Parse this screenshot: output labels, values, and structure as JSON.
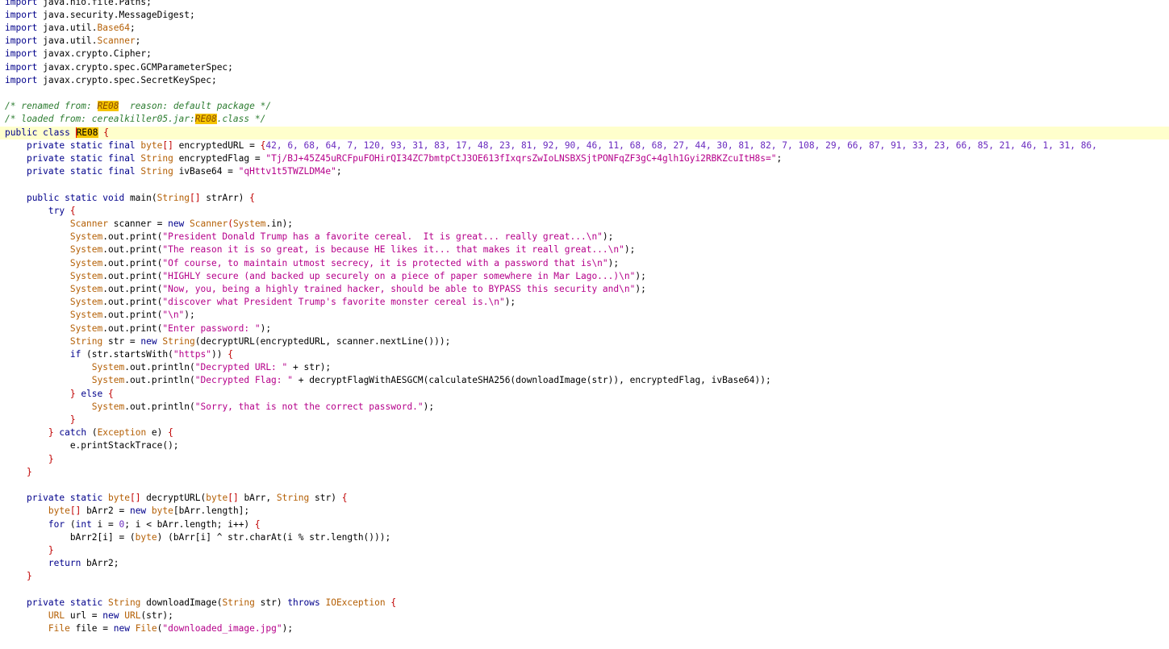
{
  "colors": {
    "keyword": "#00008b",
    "type": "#b45f04",
    "string": "#b5008a",
    "comment": "#2e7d32",
    "number": "#6a2bbf",
    "punct": "#c00000",
    "highlight": "#f5c400",
    "current_line": "#ffffcc"
  },
  "editor": {
    "current_line_index": 10,
    "lines": [
      [
        [
          "k",
          "import"
        ],
        [
          "i",
          " java.nio.file.Paths;"
        ]
      ],
      [
        [
          "k",
          "import"
        ],
        [
          "i",
          " java.security.MessageDigest;"
        ]
      ],
      [
        [
          "k",
          "import"
        ],
        [
          "i",
          " java.util."
        ],
        [
          "ty",
          "Base64"
        ],
        [
          "i",
          ";"
        ]
      ],
      [
        [
          "k",
          "import"
        ],
        [
          "i",
          " java.util."
        ],
        [
          "ty",
          "Scanner"
        ],
        [
          "i",
          ";"
        ]
      ],
      [
        [
          "k",
          "import"
        ],
        [
          "i",
          " javax.crypto.Cipher;"
        ]
      ],
      [
        [
          "k",
          "import"
        ],
        [
          "i",
          " javax.crypto.spec.GCMParameterSpec;"
        ]
      ],
      [
        [
          "k",
          "import"
        ],
        [
          "i",
          " javax.crypto.spec.SecretKeySpec;"
        ]
      ],
      [],
      [
        [
          "c",
          "/* renamed from: "
        ],
        [
          "hl",
          "RE08"
        ],
        [
          "c",
          "  reason: default package */"
        ]
      ],
      [
        [
          "c",
          "/* loaded from: cerealkiller05.jar:"
        ],
        [
          "hl",
          "RE08"
        ],
        [
          "c",
          ".class */"
        ]
      ],
      [
        [
          "k",
          "public class "
        ],
        [
          "hlc",
          "RE08"
        ],
        [
          "i",
          " "
        ],
        [
          "p",
          "{"
        ]
      ],
      [
        [
          "i",
          "    "
        ],
        [
          "k",
          "private static final "
        ],
        [
          "ty",
          "byte"
        ],
        [
          "p",
          "[]"
        ],
        [
          "i",
          " encryptedURL = "
        ],
        [
          "p",
          "{"
        ],
        [
          "n",
          "42, 6, 68, 64, 7, 120, 93, 31, 83, 17, 48, 23, 81, 92, 90, 46, 11, 68, 68, 27, 44, 30, 81, 82, 7, 108, 29, 66, 87, 91, 33, 23, 66, 85, 21, 46, 1, 31, 86,"
        ]
      ],
      [
        [
          "i",
          "    "
        ],
        [
          "k",
          "private static final "
        ],
        [
          "ty",
          "String"
        ],
        [
          "i",
          " encryptedFlag = "
        ],
        [
          "s",
          "\"Tj/BJ+45Z45uRCFpuFOHirQI34ZC7bmtpCtJ3OE613fIxqrsZwIoLNSBXSjtPONFqZF3gC+4glh1Gyi2RBKZcuItH8s=\""
        ],
        [
          "i",
          ";"
        ]
      ],
      [
        [
          "i",
          "    "
        ],
        [
          "k",
          "private static final "
        ],
        [
          "ty",
          "String"
        ],
        [
          "i",
          " ivBase64 = "
        ],
        [
          "s",
          "\"qHttv1t5TWZLDM4e\""
        ],
        [
          "i",
          ";"
        ]
      ],
      [],
      [
        [
          "i",
          "    "
        ],
        [
          "k",
          "public static void "
        ],
        [
          "i",
          "main("
        ],
        [
          "ty",
          "String"
        ],
        [
          "p",
          "[]"
        ],
        [
          "i",
          " strArr) "
        ],
        [
          "p",
          "{"
        ]
      ],
      [
        [
          "i",
          "        "
        ],
        [
          "k",
          "try "
        ],
        [
          "p",
          "{"
        ]
      ],
      [
        [
          "i",
          "            "
        ],
        [
          "ty",
          "Scanner"
        ],
        [
          "i",
          " scanner = "
        ],
        [
          "k",
          "new "
        ],
        [
          "ty",
          "Scanner"
        ],
        [
          "p",
          "("
        ],
        [
          "ty",
          "System"
        ],
        [
          "i",
          ".in);"
        ]
      ],
      [
        [
          "i",
          "            "
        ],
        [
          "ty",
          "System"
        ],
        [
          "i",
          ".out.print("
        ],
        [
          "s",
          "\"President Donald Trump has a favorite cereal.  It is great... really great...\\n\""
        ],
        [
          "i",
          ");"
        ]
      ],
      [
        [
          "i",
          "            "
        ],
        [
          "ty",
          "System"
        ],
        [
          "i",
          ".out.print("
        ],
        [
          "s",
          "\"The reason it is so great, is because HE likes it... that makes it reall great...\\n\""
        ],
        [
          "i",
          ");"
        ]
      ],
      [
        [
          "i",
          "            "
        ],
        [
          "ty",
          "System"
        ],
        [
          "i",
          ".out.print("
        ],
        [
          "s",
          "\"Of course, to maintain utmost secrecy, it is protected with a password that is\\n\""
        ],
        [
          "i",
          ");"
        ]
      ],
      [
        [
          "i",
          "            "
        ],
        [
          "ty",
          "System"
        ],
        [
          "i",
          ".out.print("
        ],
        [
          "s",
          "\"HIGHLY secure (and backed up securely on a piece of paper somewhere in Mar Lago...)\\n\""
        ],
        [
          "i",
          ");"
        ]
      ],
      [
        [
          "i",
          "            "
        ],
        [
          "ty",
          "System"
        ],
        [
          "i",
          ".out.print("
        ],
        [
          "s",
          "\"Now, you, being a highly trained hacker, should be able to BYPASS this security and\\n\""
        ],
        [
          "i",
          ");"
        ]
      ],
      [
        [
          "i",
          "            "
        ],
        [
          "ty",
          "System"
        ],
        [
          "i",
          ".out.print("
        ],
        [
          "s",
          "\"discover what President Trump's favorite monster cereal is.\\n\""
        ],
        [
          "i",
          ");"
        ]
      ],
      [
        [
          "i",
          "            "
        ],
        [
          "ty",
          "System"
        ],
        [
          "i",
          ".out.print("
        ],
        [
          "s",
          "\"\\n\""
        ],
        [
          "i",
          ");"
        ]
      ],
      [
        [
          "i",
          "            "
        ],
        [
          "ty",
          "System"
        ],
        [
          "i",
          ".out.print("
        ],
        [
          "s",
          "\"Enter password: \""
        ],
        [
          "i",
          ");"
        ]
      ],
      [
        [
          "i",
          "            "
        ],
        [
          "ty",
          "String"
        ],
        [
          "i",
          " str = "
        ],
        [
          "k",
          "new "
        ],
        [
          "ty",
          "String"
        ],
        [
          "i",
          "(decryptURL(encryptedURL, scanner.nextLine()));"
        ]
      ],
      [
        [
          "i",
          "            "
        ],
        [
          "k",
          "if "
        ],
        [
          "i",
          "(str.startsWith("
        ],
        [
          "s",
          "\"https\""
        ],
        [
          "i",
          ")) "
        ],
        [
          "p",
          "{"
        ]
      ],
      [
        [
          "i",
          "                "
        ],
        [
          "ty",
          "System"
        ],
        [
          "i",
          ".out.println("
        ],
        [
          "s",
          "\"Decrypted URL: \""
        ],
        [
          "i",
          " + str);"
        ]
      ],
      [
        [
          "i",
          "                "
        ],
        [
          "ty",
          "System"
        ],
        [
          "i",
          ".out.println("
        ],
        [
          "s",
          "\"Decrypted Flag: \""
        ],
        [
          "i",
          " + decryptFlagWithAESGCM(calculateSHA256(downloadImage(str)), encryptedFlag, ivBase64));"
        ]
      ],
      [
        [
          "i",
          "            "
        ],
        [
          "p",
          "}"
        ],
        [
          "i",
          " "
        ],
        [
          "k",
          "else "
        ],
        [
          "p",
          "{"
        ]
      ],
      [
        [
          "i",
          "                "
        ],
        [
          "ty",
          "System"
        ],
        [
          "i",
          ".out.println("
        ],
        [
          "s",
          "\"Sorry, that is not the correct password.\""
        ],
        [
          "i",
          ");"
        ]
      ],
      [
        [
          "i",
          "            "
        ],
        [
          "p",
          "}"
        ]
      ],
      [
        [
          "i",
          "        "
        ],
        [
          "p",
          "}"
        ],
        [
          "i",
          " "
        ],
        [
          "k",
          "catch "
        ],
        [
          "i",
          "("
        ],
        [
          "ty",
          "Exception"
        ],
        [
          "i",
          " e) "
        ],
        [
          "p",
          "{"
        ]
      ],
      [
        [
          "i",
          "            e.printStackTrace();"
        ]
      ],
      [
        [
          "i",
          "        "
        ],
        [
          "p",
          "}"
        ]
      ],
      [
        [
          "i",
          "    "
        ],
        [
          "p",
          "}"
        ]
      ],
      [],
      [
        [
          "i",
          "    "
        ],
        [
          "k",
          "private static "
        ],
        [
          "ty",
          "byte"
        ],
        [
          "p",
          "[]"
        ],
        [
          "i",
          " decryptURL("
        ],
        [
          "ty",
          "byte"
        ],
        [
          "p",
          "[]"
        ],
        [
          "i",
          " bArr, "
        ],
        [
          "ty",
          "String"
        ],
        [
          "i",
          " str) "
        ],
        [
          "p",
          "{"
        ]
      ],
      [
        [
          "i",
          "        "
        ],
        [
          "ty",
          "byte"
        ],
        [
          "p",
          "[]"
        ],
        [
          "i",
          " bArr2 = "
        ],
        [
          "k",
          "new "
        ],
        [
          "ty",
          "byte"
        ],
        [
          "i",
          "[bArr.length];"
        ]
      ],
      [
        [
          "i",
          "        "
        ],
        [
          "k",
          "for "
        ],
        [
          "i",
          "("
        ],
        [
          "k",
          "int "
        ],
        [
          "i",
          "i = "
        ],
        [
          "n",
          "0"
        ],
        [
          "i",
          "; i < bArr.length; i++) "
        ],
        [
          "p",
          "{"
        ]
      ],
      [
        [
          "i",
          "            bArr2[i] = ("
        ],
        [
          "ty",
          "byte"
        ],
        [
          "i",
          ") (bArr[i] ^ str.charAt(i % str.length()));"
        ]
      ],
      [
        [
          "i",
          "        "
        ],
        [
          "p",
          "}"
        ]
      ],
      [
        [
          "i",
          "        "
        ],
        [
          "k",
          "return "
        ],
        [
          "i",
          "bArr2;"
        ]
      ],
      [
        [
          "i",
          "    "
        ],
        [
          "p",
          "}"
        ]
      ],
      [],
      [
        [
          "i",
          "    "
        ],
        [
          "k",
          "private static "
        ],
        [
          "ty",
          "String"
        ],
        [
          "i",
          " downloadImage("
        ],
        [
          "ty",
          "String"
        ],
        [
          "i",
          " str) "
        ],
        [
          "k",
          "throws "
        ],
        [
          "ty",
          "IOException"
        ],
        [
          "i",
          " "
        ],
        [
          "p",
          "{"
        ]
      ],
      [
        [
          "i",
          "        "
        ],
        [
          "ty",
          "URL"
        ],
        [
          "i",
          " url = "
        ],
        [
          "k",
          "new "
        ],
        [
          "ty",
          "URL"
        ],
        [
          "i",
          "(str);"
        ]
      ],
      [
        [
          "i",
          "        "
        ],
        [
          "ty",
          "File"
        ],
        [
          "i",
          " file = "
        ],
        [
          "k",
          "new "
        ],
        [
          "ty",
          "File"
        ],
        [
          "i",
          "("
        ],
        [
          "s",
          "\"downloaded_image.jpg\""
        ],
        [
          "i",
          ");"
        ]
      ]
    ]
  }
}
